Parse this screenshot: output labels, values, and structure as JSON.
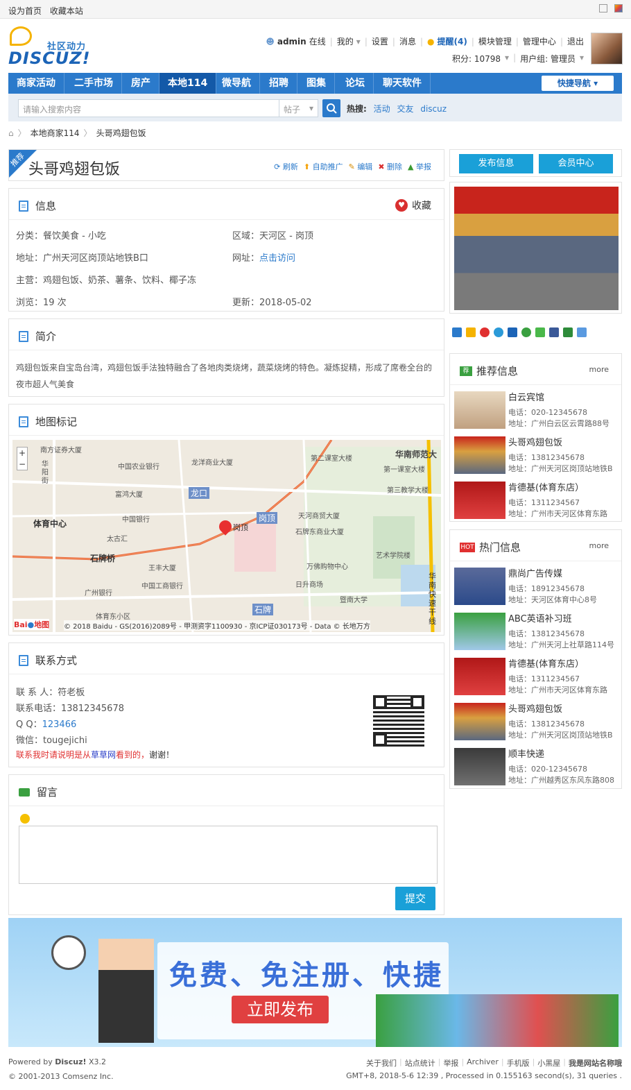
{
  "topbar": {
    "set_home": "设为首页",
    "bookmark": "收藏本站"
  },
  "logo": {
    "tagline": "社区动力",
    "wordmark": "DISCUZ!"
  },
  "user": {
    "name": "admin",
    "status": "在线",
    "mine": "我的",
    "settings": "设置",
    "messages": "消息",
    "reminders": "提醒(4)",
    "module_manage": "模块管理",
    "admin_center": "管理中心",
    "logout": "退出",
    "points": "积分: 10798",
    "group": "用户组: 管理员"
  },
  "nav": {
    "items": [
      "商家活动",
      "二手市场",
      "房产",
      "本地114",
      "微导航",
      "招聘",
      "图集",
      "论坛",
      "聊天软件"
    ],
    "current": "本地114",
    "quick": "快捷导航"
  },
  "search": {
    "placeholder": "请输入搜索内容",
    "type": "帖子",
    "hot_label": "热搜:",
    "hot": [
      "活动",
      "交友",
      "discuz"
    ]
  },
  "breadcrumb": {
    "level1": "本地商家114",
    "level2": "头哥鸡翅包饭"
  },
  "listing": {
    "badge": "推荐",
    "title": "头哥鸡翅包饭",
    "actions": [
      "刷新",
      "自助推广",
      "编辑",
      "删除",
      "举报"
    ]
  },
  "info": {
    "title": "信息",
    "favorite": "收藏",
    "category": "分类：餐饮美食 - 小吃",
    "area": "区域：天河区 - 岗顶",
    "address": "地址：广州天河区岗顶站地铁B口",
    "website_label": "网址：",
    "website_link": "点击访问",
    "main": "主营：鸡翅包饭、奶茶、薯条、饮料、椰子冻",
    "views": "浏览：19 次",
    "updated": "更新：2018-05-02"
  },
  "intro": {
    "title": "简介",
    "text": "鸡翅包饭来自宝岛台湾，鸡翅包饭手法独特融合了各地肉类烧烤，蔬菜烧烤的特色。凝炼捉精，形成了席卷全台的夜市超人气美食"
  },
  "map": {
    "title": "地图标记",
    "marker": "岗顶",
    "labels": [
      "南方证券大厦",
      "华阳街",
      "中国农业银行",
      "龙洋商业大厦",
      "第二课室大楼",
      "华南师范大",
      "第一课室大楼",
      "富鸿大厦",
      "龙口",
      "第三教学大楼",
      "体育中心",
      "中国银行",
      "岗顶",
      "天河商贸大厦",
      "太古汇",
      "石牌东商业大厦",
      "石牌桥",
      "王丰大厦",
      "万佛购物中心",
      "中国工商银行",
      "广州银行",
      "日升商场",
      "暨南大学",
      "体育东小区",
      "石牌",
      "华南快速干线",
      "艺术学院楼"
    ],
    "copyright": "© 2018 Baidu - GS(2016)2089号 - 甲测资字1100930 - 京ICP证030173号 - Data © 长地万方"
  },
  "contact": {
    "title": "联系方式",
    "person": "联 系 人：符老板",
    "phone": "联系电话：13812345678",
    "qq_label": "Q Q：",
    "qq": "123466",
    "wechat": "微信：tougejichi",
    "note_a": "联系我时请说明是从",
    "note_b": "草草网",
    "note_c": "看到的，",
    "note_d": "谢谢！"
  },
  "message": {
    "title": "留言",
    "submit": "提交"
  },
  "side": {
    "post": "发布信息",
    "member": "会员中心"
  },
  "recommend": {
    "title": "推荐信息",
    "more": "more",
    "badge": "荐",
    "items": [
      {
        "name": "白云宾馆",
        "tel": "电话：020-12345678",
        "addr": "地址：广州白云区云霄路88号"
      },
      {
        "name": "头哥鸡翅包饭",
        "tel": "电话：13812345678",
        "addr": "地址：广州天河区岗顶站地铁B"
      },
      {
        "name": "肯德基(体育东店）",
        "tel": "电话：1311234567",
        "addr": "地址：广州市天河区体育东路"
      }
    ]
  },
  "hotinfo": {
    "title": "热门信息",
    "more": "more",
    "badge": "HOT",
    "items": [
      {
        "name": "鼎尚广告传媒",
        "tel": "电话：18912345678",
        "addr": "地址：天河区体育中心8号"
      },
      {
        "name": "ABC英语补习班",
        "tel": "电话：13812345678",
        "addr": "地址：广州天河上社草路114号"
      },
      {
        "name": "肯德基(体育东店）",
        "tel": "电话：1311234567",
        "addr": "地址：广州市天河区体育东路"
      },
      {
        "name": "头哥鸡翅包饭",
        "tel": "电话：13812345678",
        "addr": "地址：广州天河区岗顶站地铁B"
      },
      {
        "name": "顺丰快递",
        "tel": "电话：020-12345678",
        "addr": "地址：广州越秀区东风东路808"
      }
    ]
  },
  "banner": {
    "slogan": "免费、免注册、快捷",
    "cta": "立即发布"
  },
  "footer": {
    "powered": "Powered by",
    "brand": "Discuz!",
    "version": "X3.2",
    "copyright": "© 2001-2013 Comsenz Inc.",
    "links": [
      "关于我们",
      "站点统计",
      "举报",
      "Archiver",
      "手机版",
      "小黑屋",
      "我是网站名称哦"
    ],
    "stats": "GMT+8, 2018-5-6 12:39 , Processed in 0.155163 second(s), 31 queries ."
  },
  "colors": {
    "brand_blue": "#2b7acb",
    "accent_cyan": "#1aa0d8",
    "danger": "#d93030"
  }
}
